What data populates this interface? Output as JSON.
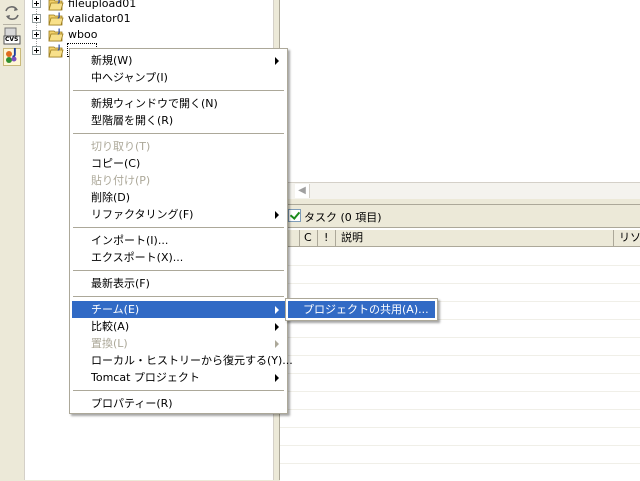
{
  "tree": {
    "items": [
      {
        "label": "fileupload01",
        "selected": false
      },
      {
        "label": "validator01",
        "selected": false
      },
      {
        "label": "wboo",
        "selected": false
      },
      {
        "label": "",
        "selected": true
      }
    ]
  },
  "left_strip": {
    "icons": [
      "refresh-icon",
      "cvs-perspective-icon",
      "java-perspective-icon"
    ],
    "cvs_text": "CVS",
    "java_text": "J"
  },
  "tasks": {
    "title": "タスク (0 項目)",
    "columns": [
      "C",
      "!",
      "説明",
      "リソ"
    ]
  },
  "context_menu": {
    "items": [
      {
        "label": "新規(W)",
        "submenu": true,
        "disabled": false
      },
      {
        "label": "中へジャンプ(I)",
        "submenu": false,
        "disabled": false
      },
      {
        "label": "新規ウィンドウで開く(N)",
        "submenu": false,
        "disabled": false
      },
      {
        "label": "型階層を開く(R)",
        "submenu": false,
        "disabled": false
      },
      {
        "label": "切り取り(T)",
        "submenu": false,
        "disabled": true
      },
      {
        "label": "コピー(C)",
        "submenu": false,
        "disabled": false
      },
      {
        "label": "貼り付け(P)",
        "submenu": false,
        "disabled": true
      },
      {
        "label": "削除(D)",
        "submenu": false,
        "disabled": false
      },
      {
        "label": "リファクタリング(F)",
        "submenu": true,
        "disabled": false
      },
      {
        "label": "インポート(I)...",
        "submenu": false,
        "disabled": false
      },
      {
        "label": "エクスポート(X)...",
        "submenu": false,
        "disabled": false
      },
      {
        "label": "最新表示(F)",
        "submenu": false,
        "disabled": false
      },
      {
        "label": "チーム(E)",
        "submenu": true,
        "disabled": false,
        "highlighted": true
      },
      {
        "label": "比較(A)",
        "submenu": true,
        "disabled": false
      },
      {
        "label": "置換(L)",
        "submenu": true,
        "disabled": true
      },
      {
        "label": "ローカル・ヒストリーから復元する(Y)...",
        "submenu": false,
        "disabled": false
      },
      {
        "label": "Tomcat プロジェクト",
        "submenu": true,
        "disabled": false
      },
      {
        "label": "プロパティー(R)",
        "submenu": false,
        "disabled": false
      }
    ]
  },
  "team_submenu": {
    "items": [
      {
        "label": "プロジェクトの共用(A)...",
        "highlighted": true
      }
    ]
  },
  "colors": {
    "highlight": "#316ac5",
    "disabled_text": "#aca899",
    "chrome": "#ece9d8"
  }
}
